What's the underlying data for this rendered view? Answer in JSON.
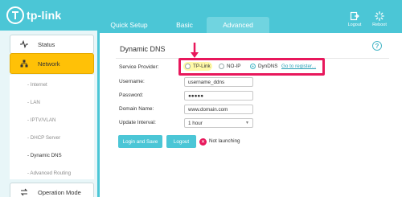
{
  "header": {
    "brand": "tp-link",
    "tabs": [
      "Quick Setup",
      "Basic",
      "Advanced"
    ],
    "logout_label": "Logout",
    "reboot_label": "Reboot"
  },
  "sidebar": {
    "status_label": "Status",
    "network_label": "Network",
    "subitems": [
      "- Internet",
      "- LAN",
      "- IPTV/VLAN",
      "- DHCP Server",
      "- Dynamic DNS",
      "- Advanced Routing"
    ],
    "active_subitem": "- Dynamic DNS",
    "opmode_label": "Operation Mode"
  },
  "main": {
    "title": "Dynamic DNS",
    "help_icon": "?",
    "service_provider_label": "Service Provider:",
    "providers": [
      "TP-Link",
      "NO-IP",
      "DynDNS"
    ],
    "selected_provider": "DynDNS",
    "register_link": "Go to register...",
    "username_label": "Username:",
    "username_value": "username_ddns",
    "password_label": "Password:",
    "password_value": "●●●●●",
    "domain_label": "Domain Name:",
    "domain_value": "www.domain.com",
    "interval_label": "Update Interval:",
    "interval_value": "1 hour",
    "login_save_button": "Login and Save",
    "logout_button": "Logout",
    "status_text": "Not launching"
  },
  "colors": {
    "accent": "#4bc6d6",
    "highlight_box": "#e8185c",
    "active_menu": "#ffc107"
  }
}
